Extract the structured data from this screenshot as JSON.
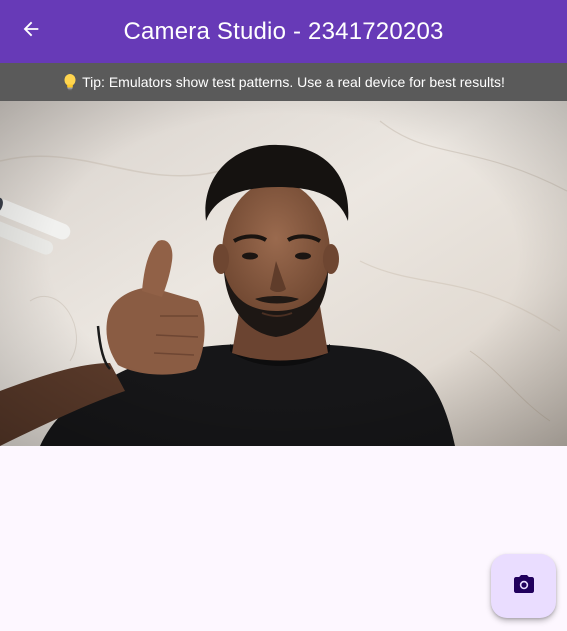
{
  "appbar": {
    "title": "Camera Studio - 2341720203",
    "back_icon": "arrow-back-icon",
    "color": "#673ab7"
  },
  "tip": {
    "icon": "lightbulb-icon",
    "text": "Tip: Emulators show test patterns. Use a real device for best results!"
  },
  "preview": {
    "content": "camera-preview-image"
  },
  "fab": {
    "icon": "camera-icon",
    "color": "#eaddff"
  }
}
